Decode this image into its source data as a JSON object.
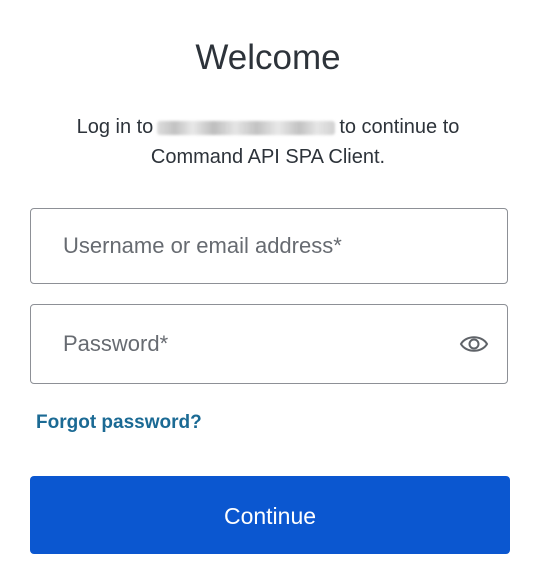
{
  "heading": "Welcome",
  "subtitle": {
    "prefix": "Log in to",
    "suffix": "to continue to",
    "line2": "Command API SPA Client."
  },
  "username": {
    "placeholder": "Username or email address*",
    "value": ""
  },
  "password": {
    "placeholder": "Password*",
    "value": "",
    "toggle_icon": "eye-icon"
  },
  "forgot_password_label": "Forgot password?",
  "continue_label": "Continue",
  "colors": {
    "primary": "#0b57d0",
    "link": "#1b6a94",
    "border": "#8d9096",
    "text": "#2d333a"
  }
}
